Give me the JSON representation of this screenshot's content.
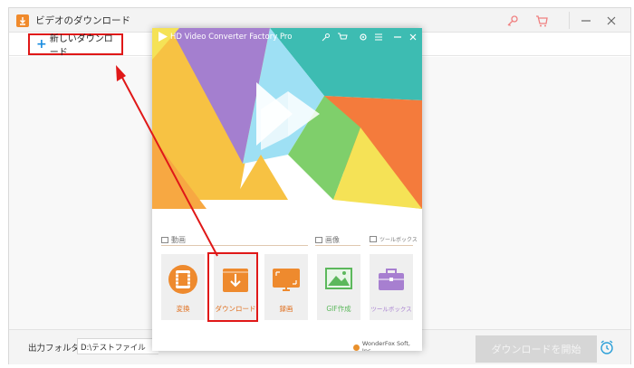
{
  "main_window": {
    "title": "ビデオのダウンロード",
    "new_download_label": "新しいダウンロード",
    "output_folder_label": "出力フォルダ：",
    "output_folder_path": "D:\\テストファイル",
    "start_download_label": "ダウンロードを開始"
  },
  "overlay": {
    "title": "HD Video Converter Factory Pro",
    "sections": {
      "video": "動画",
      "image": "画像",
      "toolbox": "ツールボックス"
    },
    "tiles": [
      {
        "label": "変換"
      },
      {
        "label": "ダウンロード"
      },
      {
        "label": "録画"
      },
      {
        "label": "GIF作成"
      },
      {
        "label": "ツールボックス"
      }
    ],
    "brand": "WonderFox Soft, Inc."
  },
  "colors": {
    "highlight_red": "#e01818",
    "accent_orange": "#f08a2c",
    "accent_blue": "#1a8ce0"
  }
}
